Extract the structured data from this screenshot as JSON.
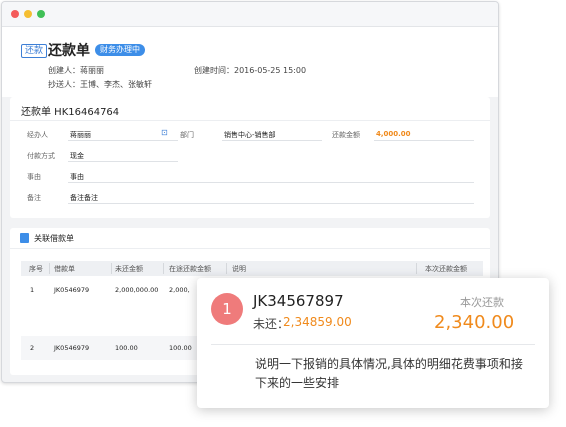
{
  "header": {
    "back_tag": "还款",
    "title": "还款单",
    "status": "财务办理中",
    "creator": "创建人：蒋丽丽",
    "created_time": "创建时间：2016-05-25 15:00",
    "cc": "抄送人：王博、李杰、张敏轩"
  },
  "form": {
    "title": "还款单  HK16464764",
    "handler_label": "经办人",
    "handler_value": "蒋丽丽",
    "dept_label": "部门",
    "dept_value": "销售中心-销售部",
    "amount_label": "还款金额",
    "amount_value": "4,000.00",
    "pay_label": "付款方式",
    "pay_value": "现金",
    "reason_label": "事由",
    "reason_value": "事由",
    "note_label": "备注",
    "note_value": "备注备注"
  },
  "loans": {
    "title": "关联借款单",
    "columns": [
      "序号",
      "借款单",
      "未还金额",
      "在途还款金额",
      "说明",
      "本次还款金额"
    ],
    "rows": [
      {
        "no": "1",
        "id": "JK0546979",
        "unpaid": "2,000,000.00",
        "in_transit": "2,000,"
      },
      {
        "no": "2",
        "id": "JK0546979",
        "unpaid": "100.00",
        "in_transit": "100.00"
      }
    ]
  },
  "popup": {
    "badge": "1",
    "loan_no": "JK34567897",
    "unpaid_label": "未还：",
    "unpaid_value": "2,34859.00",
    "current_label": "本次还款",
    "current_value": "2,340.00",
    "description": "说明一下报销的具体情况,具体的明细花费事项和接下来的一些安排"
  },
  "colors": {
    "accent": "#3d8ee8",
    "amount": "#f08a1c",
    "badge": "#ef7b7b"
  }
}
